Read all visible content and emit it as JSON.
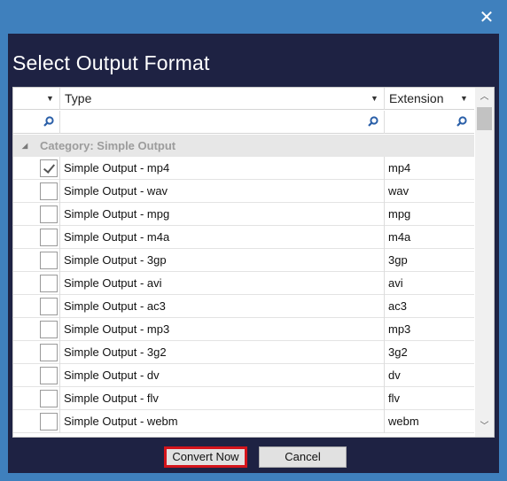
{
  "window": {
    "close_glyph": "✕"
  },
  "dialog": {
    "title": "Select Output Format"
  },
  "grid": {
    "columns": {
      "type_label": "Type",
      "extension_label": "Extension"
    },
    "category_label": "Category:  Simple Output",
    "rows": [
      {
        "type": "Simple Output - mp4",
        "ext": "mp4",
        "checked": true
      },
      {
        "type": "Simple Output - wav",
        "ext": "wav",
        "checked": false
      },
      {
        "type": "Simple Output - mpg",
        "ext": "mpg",
        "checked": false
      },
      {
        "type": "Simple Output - m4a",
        "ext": "m4a",
        "checked": false
      },
      {
        "type": "Simple Output - 3gp",
        "ext": "3gp",
        "checked": false
      },
      {
        "type": "Simple Output - avi",
        "ext": "avi",
        "checked": false
      },
      {
        "type": "Simple Output - ac3",
        "ext": "ac3",
        "checked": false
      },
      {
        "type": "Simple Output - mp3",
        "ext": "mp3",
        "checked": false
      },
      {
        "type": "Simple Output - 3g2",
        "ext": "3g2",
        "checked": false
      },
      {
        "type": "Simple Output - dv",
        "ext": "dv",
        "checked": false
      },
      {
        "type": "Simple Output - flv",
        "ext": "flv",
        "checked": false
      },
      {
        "type": "Simple Output - webm",
        "ext": "webm",
        "checked": false
      }
    ]
  },
  "buttons": {
    "convert_label": "Convert Now",
    "cancel_label": "Cancel"
  },
  "colors": {
    "window_frame": "#3f80bd",
    "dialog_background": "#1e2243",
    "highlight_border": "#d4141b",
    "search_icon": "#2a5fa8"
  },
  "icons": {
    "close": "close-icon",
    "search": "search-icon",
    "sort": "chevron-down-icon",
    "collapse": "triangle-down-icon",
    "check": "checkmark-icon"
  }
}
